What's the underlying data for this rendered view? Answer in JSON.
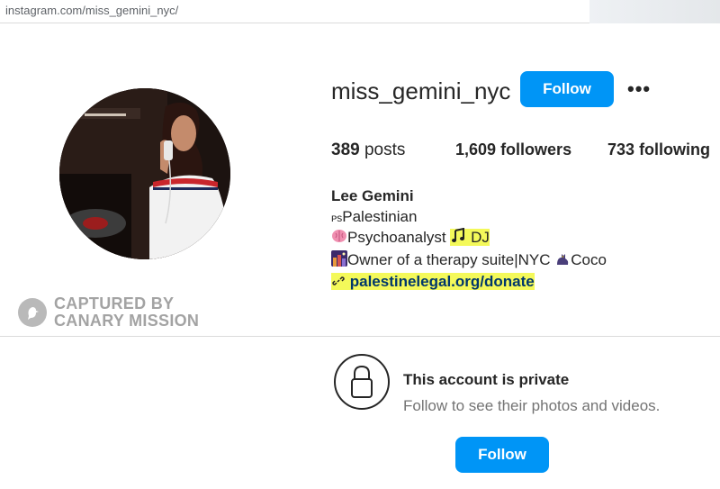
{
  "browser": {
    "url": "instagram.com/miss_gemini_nyc/"
  },
  "profile": {
    "username": "miss_gemini_nyc",
    "follow_label": "Follow",
    "more_label": "•••",
    "stats": {
      "posts_count": "389",
      "posts_label": "posts",
      "followers_count": "1,609",
      "followers_label": "followers",
      "following_count": "733",
      "following_label": "following"
    },
    "bio": {
      "name": "Lee Gemini",
      "line1_prefix": "ᴘs",
      "line1_text": "Palestinian",
      "line2_text": "Psychoanalyst",
      "line2_highlight": "DJ",
      "line3_text": "Owner of a therapy suite|NYC",
      "line3_suffix": "Coco",
      "link": "palestinelegal.org/donate"
    },
    "icons": {
      "brain": "brain-emoji",
      "music": "music-notes-emoji",
      "city": "night-city-emoji",
      "cat": "black-cat-emoji",
      "link": "link-icon"
    }
  },
  "watermark": {
    "line1": "CAPTURED BY",
    "line2": "CANARY MISSION"
  },
  "private": {
    "title": "This account is private",
    "subtitle": "Follow to see their photos and videos.",
    "follow_label": "Follow"
  },
  "colors": {
    "primary_button": "#0095f6",
    "highlight": "#f4f95a",
    "link": "#00376b"
  }
}
